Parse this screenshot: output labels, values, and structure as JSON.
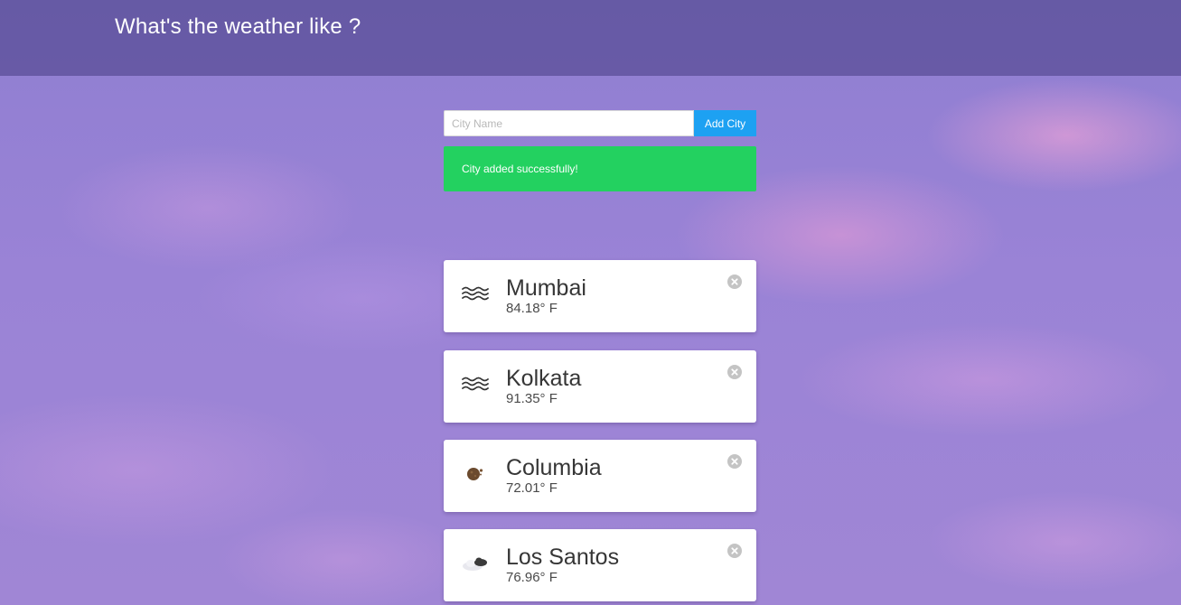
{
  "header": {
    "title": "What's the weather like ?"
  },
  "form": {
    "city_input_value": "",
    "city_input_placeholder": "City Name",
    "add_button_label": "Add City"
  },
  "notification": {
    "message": "City added successfully!",
    "color": "#23d160"
  },
  "cities": [
    {
      "name": "Mumbai",
      "temperature": "84.18° F",
      "icon": "haze-icon"
    },
    {
      "name": "Kolkata",
      "temperature": "91.35° F",
      "icon": "haze-icon"
    },
    {
      "name": "Columbia",
      "temperature": "72.01° F",
      "icon": "moon-icon"
    },
    {
      "name": "Los Santos",
      "temperature": "76.96° F",
      "icon": "cloudy-night-icon"
    }
  ],
  "colors": {
    "accent": "#1da1f2",
    "success": "#23d160",
    "header_overlay": "#463c82"
  }
}
